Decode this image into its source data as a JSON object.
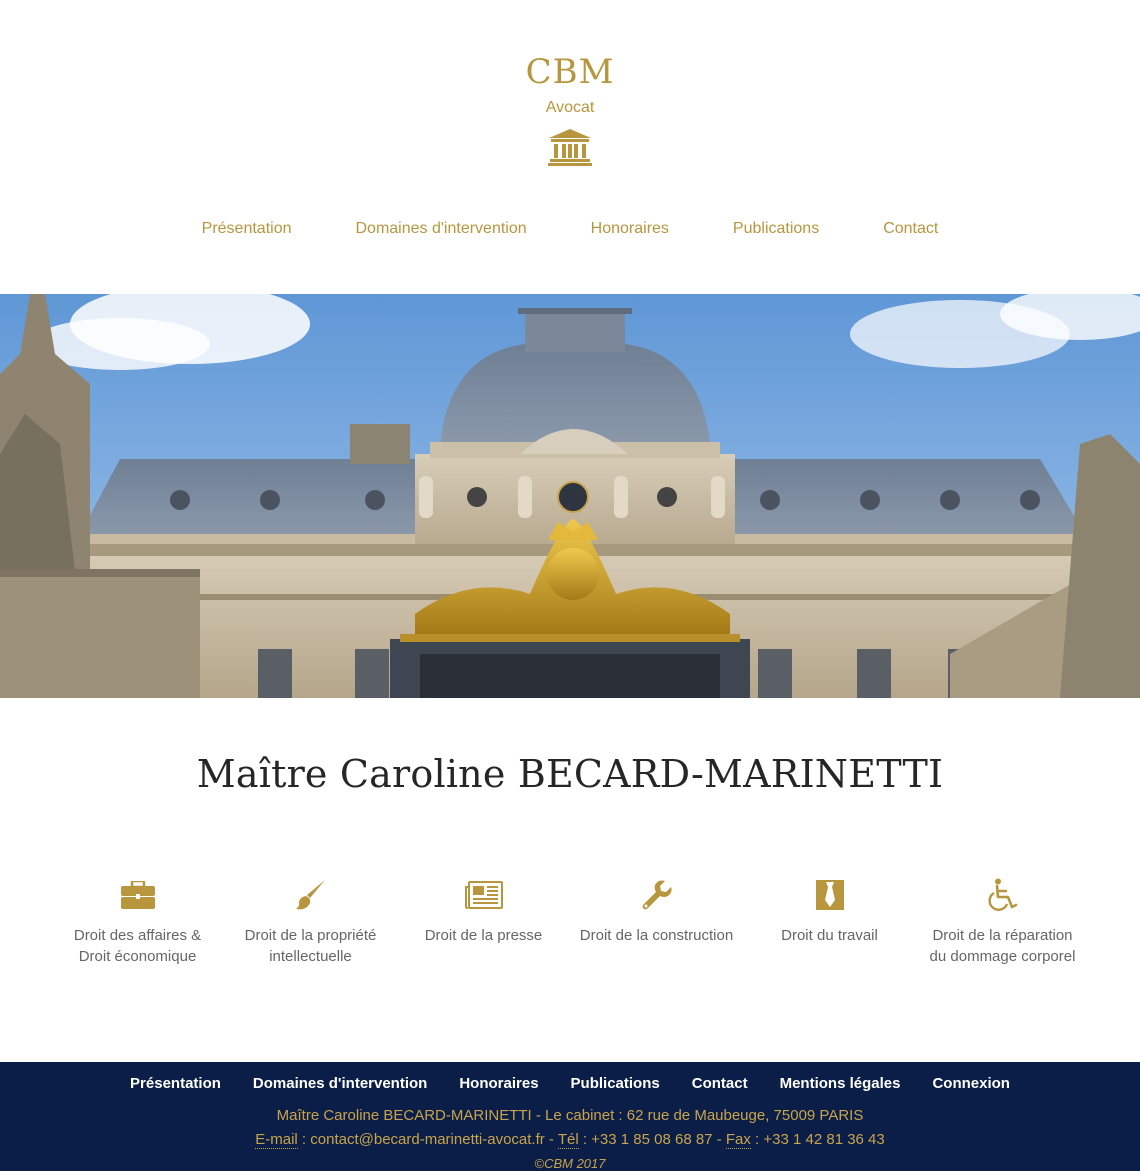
{
  "brand": {
    "name": "CBM",
    "subtitle": "Avocat",
    "logo_icon": "courthouse-icon"
  },
  "top_nav": [
    "Présentation",
    "Domaines d'intervention",
    "Honoraires",
    "Publications",
    "Contact"
  ],
  "hero": {
    "description_icon": "palais-de-justice-photo"
  },
  "heading": "Maître Caroline BECARD-MARINETTI",
  "domains": [
    {
      "icon": "briefcase-icon",
      "label": "Droit des affaires & Droit économique"
    },
    {
      "icon": "paintbrush-icon",
      "label": "Droit de la propriété intellectuelle"
    },
    {
      "icon": "newspaper-icon",
      "label": "Droit de la presse"
    },
    {
      "icon": "wrench-icon",
      "label": "Droit de la construction"
    },
    {
      "icon": "tie-icon",
      "label": "Droit du travail"
    },
    {
      "icon": "wheelchair-icon",
      "label": "Droit de la réparation du dommage corporel"
    }
  ],
  "footer": {
    "nav": [
      "Présentation",
      "Domaines d'intervention",
      "Honoraires",
      "Publications",
      "Contact",
      "Mentions légales",
      "Connexion"
    ],
    "address": "Maître Caroline BECARD-MARINETTI - Le cabinet : 62 rue de Maubeuge, 75009 PARIS",
    "email_label": "E-mail",
    "email_value": " : contact@becard-marinetti-avocat.fr - ",
    "tel_label": "Tél",
    "tel_value": " : +33 1 85 08 68 87 - ",
    "fax_label": "Fax",
    "fax_value": " : +33 1 42 81 36 43",
    "copyright": "©CBM 2017"
  },
  "colors": {
    "gold": "#b8963e",
    "footer_bg": "#0b1e47",
    "footer_text": "#c9a44c"
  }
}
